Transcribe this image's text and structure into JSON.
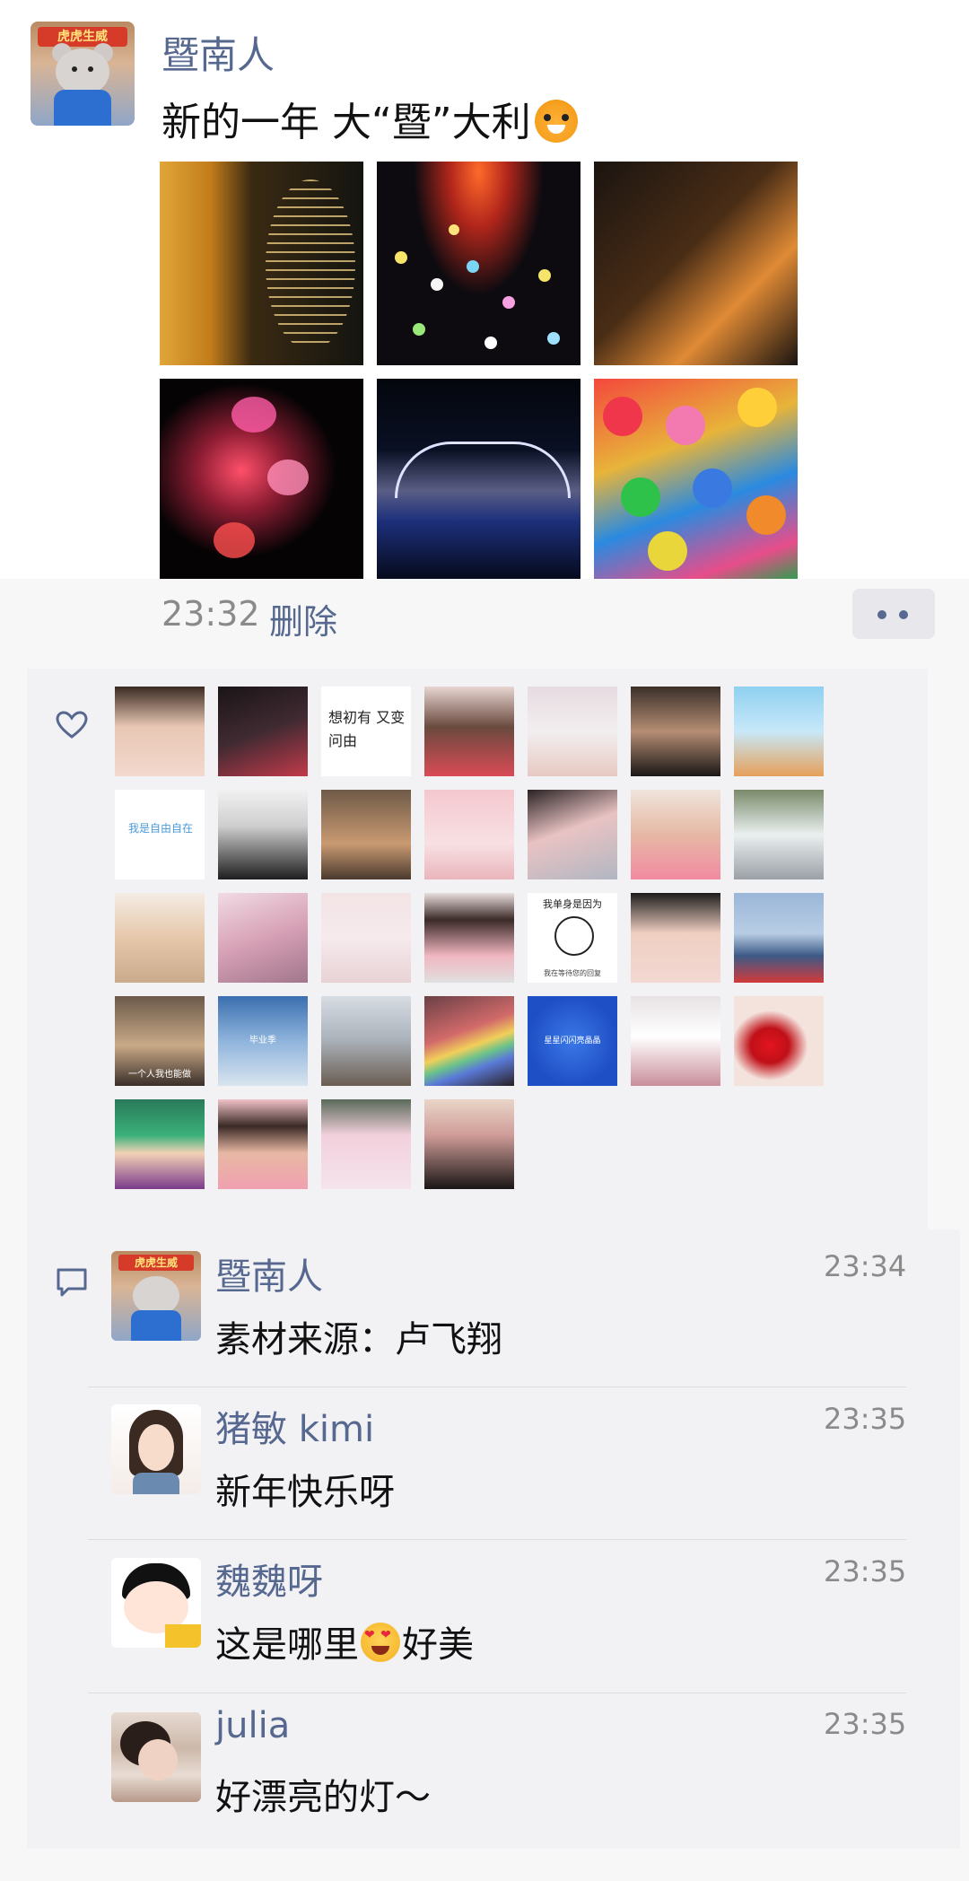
{
  "post": {
    "author": "暨南人",
    "text": "新的一年 大“暨”大利",
    "emoji": "tiger-face",
    "avatar_banner": "虎虎生威",
    "time": "23:32",
    "delete_label": "删除"
  },
  "photos": [
    {
      "name": "photo-gold-lights-building"
    },
    {
      "name": "photo-koi-lantern-bokeh"
    },
    {
      "name": "photo-string-lights-tower"
    },
    {
      "name": "photo-butterfly-lights"
    },
    {
      "name": "photo-bridge-night-river"
    },
    {
      "name": "photo-colorful-lanterns"
    }
  ],
  "likes": {
    "icon": "heart-icon",
    "avatar_texts": {
      "handwriting": "想初有 又变问由",
      "blue_text": "我是自由自在",
      "cartoon_caption": "我单身是因为",
      "cartoon_subcaption": "我在等待您的回复",
      "room_caption": "一个人我也能做",
      "sky_caption": "毕业季",
      "stars_caption": "星星闪闪亮晶晶"
    },
    "count": 32
  },
  "comments": [
    {
      "author": "暨南人",
      "time": "23:34",
      "text": "素材来源：卢飞翔"
    },
    {
      "author": "猪敏 kimi",
      "time": "23:35",
      "text": "新年快乐呀"
    },
    {
      "author": "魏魏呀",
      "time": "23:35",
      "text_before": "这是哪里",
      "text_after": "好美",
      "emoji": "heart-eyes"
    },
    {
      "author": "julia",
      "time": "23:35",
      "text": "好漂亮的灯～"
    }
  ],
  "colors": {
    "link_blue": "#56688f",
    "meta_gray": "#8a8a8a",
    "panel_bg": "#f2f2f5"
  }
}
